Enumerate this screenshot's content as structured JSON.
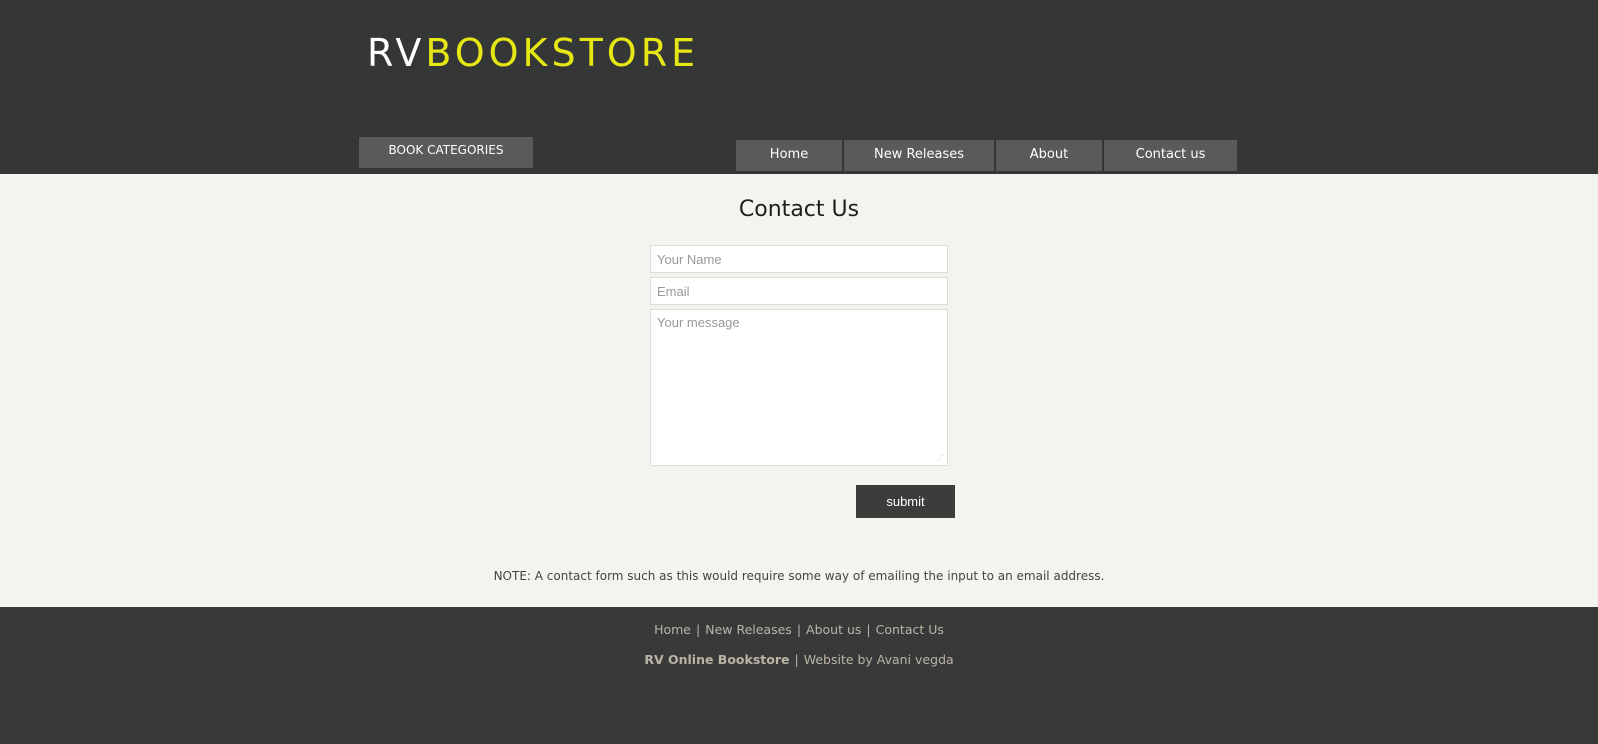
{
  "header": {
    "logo_part_a": "RV",
    "logo_part_b": "BOOKSTORE",
    "categories_button": "BOOK CATEGORIES",
    "nav": [
      {
        "label": "Home"
      },
      {
        "label": "New Releases"
      },
      {
        "label": "About"
      },
      {
        "label": "Contact us"
      }
    ]
  },
  "main": {
    "title": "Contact Us",
    "form": {
      "name_placeholder": "Your Name",
      "email_placeholder": "Email",
      "message_placeholder": "Your message",
      "submit_label": "submit"
    },
    "note": "NOTE: A contact form such as this would require some way of emailing the input to an email address."
  },
  "footer": {
    "links": [
      {
        "label": "Home"
      },
      {
        "label": "New Releases"
      },
      {
        "label": "About us"
      },
      {
        "label": "Contact Us"
      }
    ],
    "separator": "|",
    "store_name": "RV Online Bookstore",
    "credit": "Website by Avani vegda"
  },
  "colors": {
    "header_bg": "#353636",
    "accent_yellow": "#e5e614",
    "nav_bg": "#5a5a5a",
    "content_bg": "#f4f3ee",
    "footer_bg": "#3a3939",
    "footer_text": "#b8b5a6",
    "submit_bg": "#3c3c3b"
  }
}
